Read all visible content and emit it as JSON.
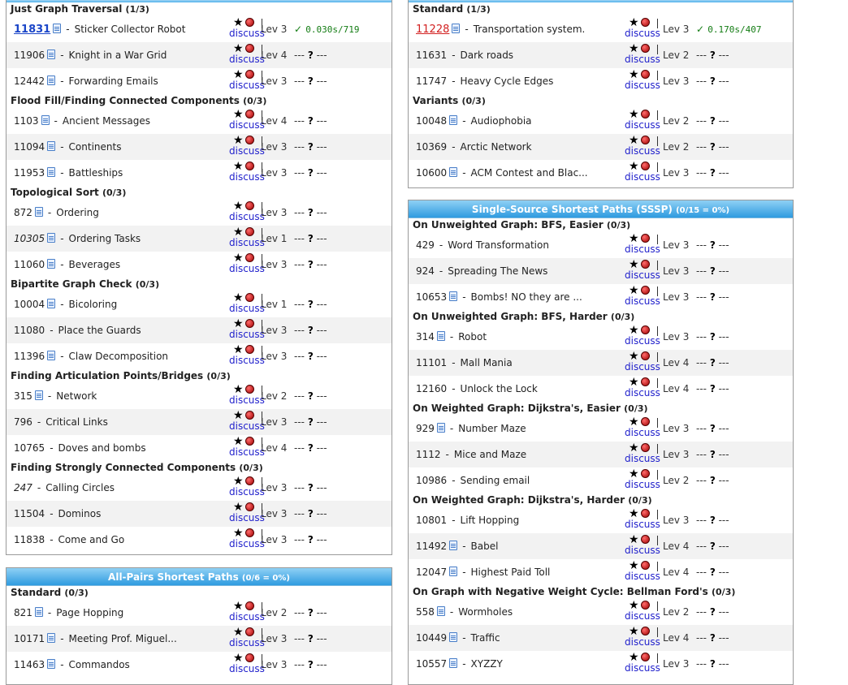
{
  "pdf_icon": "pdf-document-icon",
  "star_icon": "star-icon",
  "bomb_icon": "bomb-icon",
  "discuss_label": "discuss",
  "separator": "-",
  "panels": [
    {
      "key": "graph_traversal",
      "header": null,
      "groups": [
        {
          "title": "Just Graph Traversal",
          "count": "(1/3)",
          "rows": [
            {
              "id": "11831",
              "pdf": true,
              "name": "Sticker Collector Robot",
              "lev": "Lev 3",
              "status": "solved",
              "result": "0.030s/719"
            },
            {
              "id": "11906",
              "pdf": true,
              "name": "Knight in a War Grid",
              "lev": "Lev 4",
              "status": "none"
            },
            {
              "id": "12442",
              "pdf": true,
              "name": "Forwarding Emails",
              "lev": "Lev 3",
              "status": "none"
            }
          ]
        },
        {
          "title": "Flood Fill/Finding Connected Components",
          "count": "(0/3)",
          "rows": [
            {
              "id": "1103",
              "pdf": true,
              "name": "Ancient Messages",
              "lev": "Lev 4",
              "status": "none"
            },
            {
              "id": "11094",
              "pdf": true,
              "name": "Continents",
              "lev": "Lev 3",
              "status": "none"
            },
            {
              "id": "11953",
              "pdf": true,
              "name": "Battleships",
              "lev": "Lev 3",
              "status": "none"
            }
          ]
        },
        {
          "title": "Topological Sort",
          "count": "(0/3)",
          "rows": [
            {
              "id": "872",
              "pdf": true,
              "name": "Ordering",
              "lev": "Lev 3",
              "status": "none"
            },
            {
              "id": "10305",
              "pdf": true,
              "italic": true,
              "name": "Ordering Tasks",
              "lev": "Lev 1",
              "status": "none"
            },
            {
              "id": "11060",
              "pdf": true,
              "name": "Beverages",
              "lev": "Lev 3",
              "status": "none"
            }
          ]
        },
        {
          "title": "Bipartite Graph Check",
          "count": "(0/3)",
          "rows": [
            {
              "id": "10004",
              "pdf": true,
              "name": "Bicoloring",
              "lev": "Lev 1",
              "status": "none"
            },
            {
              "id": "11080",
              "pdf": false,
              "name": "Place the Guards",
              "lev": "Lev 3",
              "status": "none"
            },
            {
              "id": "11396",
              "pdf": true,
              "name": "Claw Decomposition",
              "lev": "Lev 3",
              "status": "none"
            }
          ]
        },
        {
          "title": "Finding Articulation Points/Bridges",
          "count": "(0/3)",
          "rows": [
            {
              "id": "315",
              "pdf": true,
              "name": "Network",
              "lev": "Lev 2",
              "status": "none"
            },
            {
              "id": "796",
              "pdf": false,
              "name": "Critical Links",
              "lev": "Lev 3",
              "status": "none"
            },
            {
              "id": "10765",
              "pdf": false,
              "name": "Doves and bombs",
              "lev": "Lev 4",
              "status": "none"
            }
          ]
        },
        {
          "title": "Finding Strongly Connected Components",
          "count": "(0/3)",
          "rows": [
            {
              "id": "247",
              "pdf": false,
              "italic": true,
              "name": "Calling Circles",
              "lev": "Lev 3",
              "status": "none"
            },
            {
              "id": "11504",
              "pdf": false,
              "name": "Dominos",
              "lev": "Lev 3",
              "status": "none"
            },
            {
              "id": "11838",
              "pdf": false,
              "name": "Come and Go",
              "lev": "Lev 3",
              "status": "none"
            }
          ]
        }
      ]
    },
    {
      "key": "apsp",
      "header": {
        "title": "All-Pairs Shortest Paths",
        "stat": "(0/6 = 0%)"
      },
      "groups": [
        {
          "title": "Standard",
          "count": "(0/3)",
          "rows": [
            {
              "id": "821",
              "pdf": true,
              "name": "Page Hopping",
              "lev": "Lev 2",
              "status": "none"
            },
            {
              "id": "10171",
              "pdf": true,
              "name": "Meeting Prof. Miguel...",
              "lev": "Lev 3",
              "status": "none"
            },
            {
              "id": "11463",
              "pdf": true,
              "name": "Commandos",
              "lev": "Lev 3",
              "status": "none"
            }
          ]
        }
      ]
    },
    {
      "key": "mst",
      "header": null,
      "groups": [
        {
          "title": "Standard",
          "count": "(1/3)",
          "rows": [
            {
              "id": "11228",
              "pdf": true,
              "name": "Transportation system.",
              "lev": "Lev 3",
              "status": "attempt",
              "result": "0.170s/407"
            },
            {
              "id": "11631",
              "pdf": false,
              "name": "Dark roads",
              "lev": "Lev 2",
              "status": "none"
            },
            {
              "id": "11747",
              "pdf": false,
              "name": "Heavy Cycle Edges",
              "lev": "Lev 3",
              "status": "none"
            }
          ]
        },
        {
          "title": "Variants",
          "count": "(0/3)",
          "rows": [
            {
              "id": "10048",
              "pdf": true,
              "name": "Audiophobia",
              "lev": "Lev 2",
              "status": "none"
            },
            {
              "id": "10369",
              "pdf": false,
              "name": "Arctic Network",
              "lev": "Lev 2",
              "status": "none"
            },
            {
              "id": "10600",
              "pdf": true,
              "name": "ACM Contest and Blac...",
              "lev": "Lev 3",
              "status": "none"
            }
          ]
        }
      ]
    },
    {
      "key": "sssp",
      "header": {
        "title": "Single-Source Shortest Paths (SSSP)",
        "stat": "(0/15 = 0%)"
      },
      "groups": [
        {
          "title": "On Unweighted Graph: BFS, Easier",
          "count": "(0/3)",
          "rows": [
            {
              "id": "429",
              "pdf": false,
              "name": "Word Transformation",
              "lev": "Lev 3",
              "status": "none"
            },
            {
              "id": "924",
              "pdf": false,
              "name": "Spreading The News",
              "lev": "Lev 3",
              "status": "none"
            },
            {
              "id": "10653",
              "pdf": true,
              "name": "Bombs! NO they are ...",
              "lev": "Lev 3",
              "status": "none"
            }
          ]
        },
        {
          "title": "On Unweighted Graph: BFS, Harder",
          "count": "(0/3)",
          "rows": [
            {
              "id": "314",
              "pdf": true,
              "name": "Robot",
              "lev": "Lev 3",
              "status": "none"
            },
            {
              "id": "11101",
              "pdf": false,
              "name": "Mall Mania",
              "lev": "Lev 4",
              "status": "none"
            },
            {
              "id": "12160",
              "pdf": false,
              "name": "Unlock the Lock",
              "lev": "Lev 4",
              "status": "none"
            }
          ]
        },
        {
          "title": "On Weighted Graph: Dijkstra's, Easier",
          "count": "(0/3)",
          "rows": [
            {
              "id": "929",
              "pdf": true,
              "name": "Number Maze",
              "lev": "Lev 3",
              "status": "none"
            },
            {
              "id": "1112",
              "pdf": false,
              "name": "Mice and Maze",
              "lev": "Lev 3",
              "status": "none"
            },
            {
              "id": "10986",
              "pdf": false,
              "name": "Sending email",
              "lev": "Lev 2",
              "status": "none"
            }
          ]
        },
        {
          "title": "On Weighted Graph: Dijkstra's, Harder",
          "count": "(0/3)",
          "rows": [
            {
              "id": "10801",
              "pdf": false,
              "name": "Lift Hopping",
              "lev": "Lev 3",
              "status": "none"
            },
            {
              "id": "11492",
              "pdf": true,
              "name": "Babel",
              "lev": "Lev 4",
              "status": "none"
            },
            {
              "id": "12047",
              "pdf": true,
              "name": "Highest Paid Toll",
              "lev": "Lev 4",
              "status": "none"
            }
          ]
        },
        {
          "title": "On Graph with Negative Weight Cycle: Bellman Ford's",
          "count": "(0/3)",
          "rows": [
            {
              "id": "558",
              "pdf": true,
              "name": "Wormholes",
              "lev": "Lev 2",
              "status": "none"
            },
            {
              "id": "10449",
              "pdf": true,
              "name": "Traffic",
              "lev": "Lev 4",
              "status": "none"
            },
            {
              "id": "10557",
              "pdf": true,
              "name": "XYZZY",
              "lev": "Lev 3",
              "status": "none"
            }
          ]
        }
      ]
    }
  ]
}
